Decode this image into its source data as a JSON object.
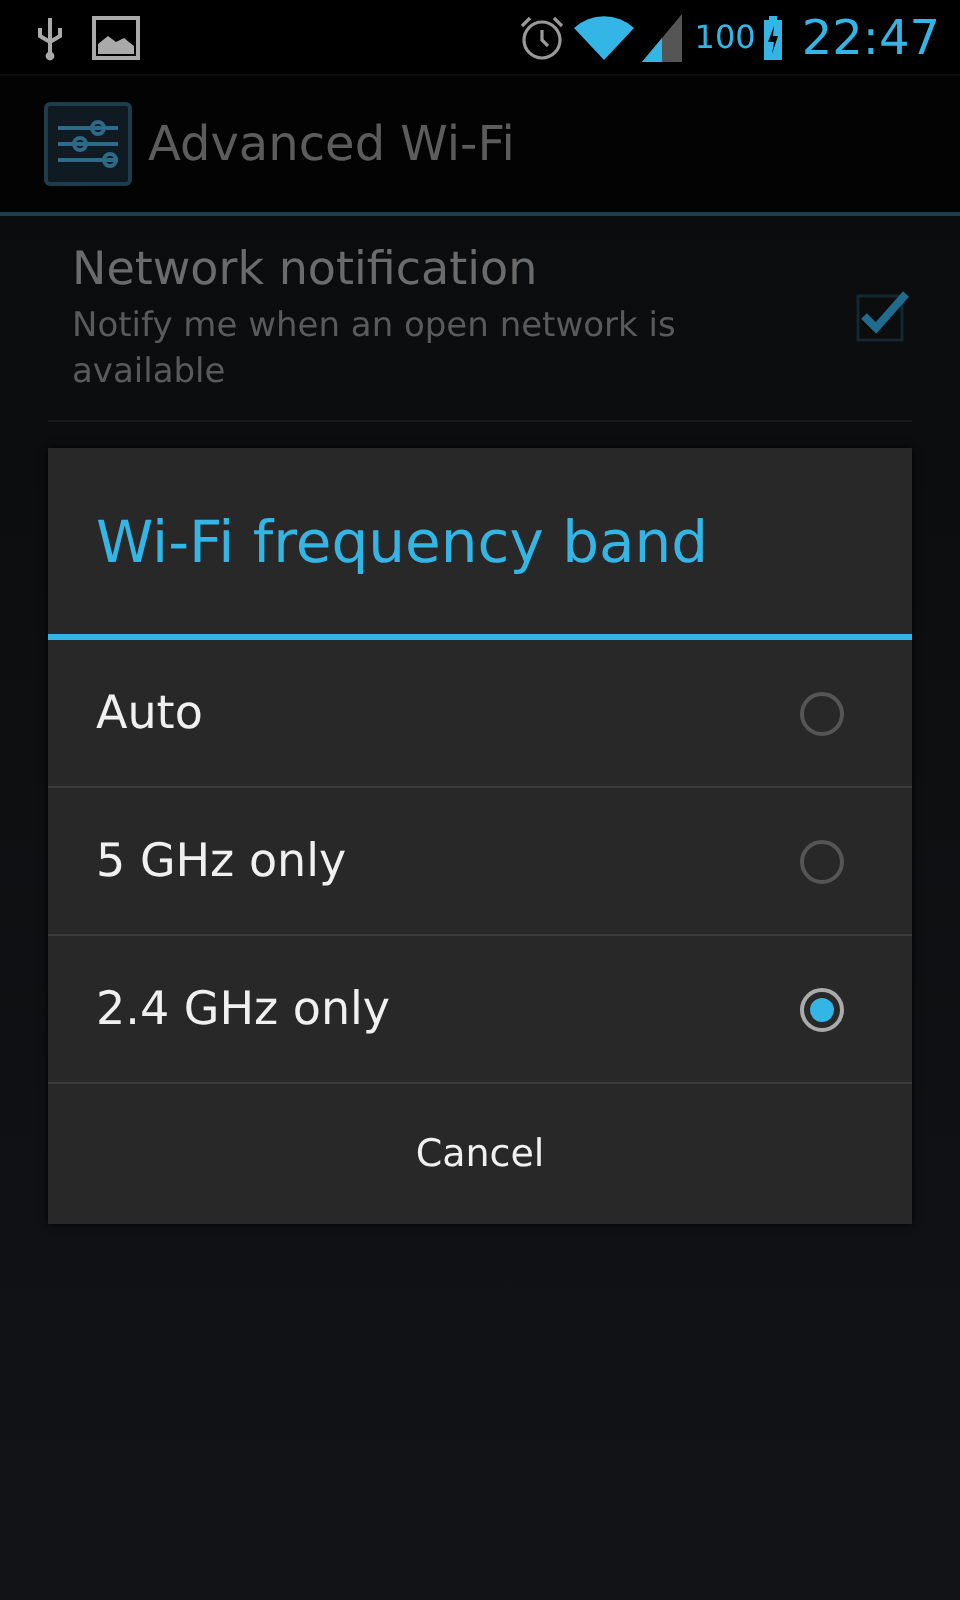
{
  "status_bar": {
    "battery": "100",
    "time": "22:47"
  },
  "action_bar": {
    "title": "Advanced Wi-Fi"
  },
  "settings": [
    {
      "title": "Network notification",
      "summary": "Notify me when an open network is available",
      "checked": true
    }
  ],
  "dialog": {
    "title": "Wi-Fi frequency band",
    "options": [
      {
        "label": "Auto",
        "selected": false
      },
      {
        "label": "5 GHz only",
        "selected": false
      },
      {
        "label": "2.4 GHz only",
        "selected": true
      }
    ],
    "button": "Cancel"
  }
}
